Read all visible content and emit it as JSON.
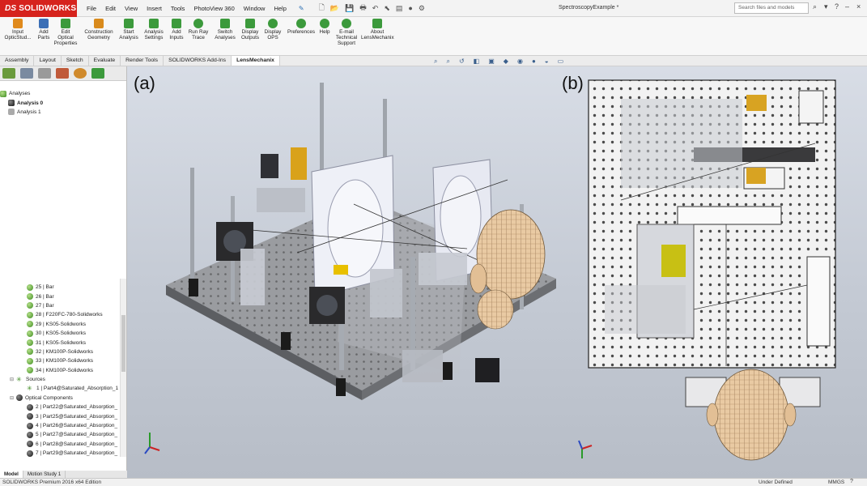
{
  "app": {
    "logo": "SOLIDWORKS",
    "menus": [
      "File",
      "Edit",
      "View",
      "Insert",
      "Tools",
      "PhotoView 360",
      "Window",
      "Help"
    ],
    "document_title": "SpectroscopyExample *",
    "search_placeholder": "Search files and models"
  },
  "ribbon": [
    {
      "label": "Input OpticStud...",
      "icon": "optic-stud-icon",
      "color": "#e08a1c"
    },
    {
      "label": "Add Parts",
      "icon": "add-parts-icon",
      "color": "#3b6fb6"
    },
    {
      "label": "Edit Optical Properties",
      "icon": "edit-optical-icon",
      "color": "#3c9a3c"
    },
    {
      "label": "Construction Geometry",
      "icon": "construction-geometry-icon",
      "color": "#d98a1c"
    },
    {
      "label": "Start Analysis",
      "icon": "start-analysis-icon",
      "color": "#3c9a3c"
    },
    {
      "label": "Analysis Settings",
      "icon": "analysis-settings-icon",
      "color": "#3c9a3c"
    },
    {
      "label": "Add Inputs",
      "icon": "add-inputs-icon",
      "color": "#3c9a3c"
    },
    {
      "label": "Run Ray Trace",
      "icon": "ray-trace-icon",
      "color": "#3c9a3c"
    },
    {
      "label": "Switch Analyses",
      "icon": "switch-analyses-icon",
      "color": "#3c9a3c"
    },
    {
      "label": "Display Outputs",
      "icon": "display-outputs-icon",
      "color": "#3c9a3c"
    },
    {
      "label": "Display OPS",
      "icon": "display-ops-icon",
      "color": "#3c9a3c"
    },
    {
      "label": "Preferences",
      "icon": "preferences-icon",
      "color": "#3c9a3c"
    },
    {
      "label": "Help",
      "icon": "help-icon",
      "color": "#3c9a3c"
    },
    {
      "label": "E-mail Technical Support",
      "icon": "email-support-icon",
      "color": "#3c9a3c"
    },
    {
      "label": "About LensMechanix",
      "icon": "about-icon",
      "color": "#3c9a3c"
    }
  ],
  "tabs": [
    "Assembly",
    "Layout",
    "Sketch",
    "Evaluate",
    "Render Tools",
    "SOLIDWORKS Add-Ins",
    "LensMechanix"
  ],
  "active_tab": "LensMechanix",
  "tree_top": {
    "root": "Analyses",
    "items": [
      "Analysis 0",
      "Analysis 1"
    ]
  },
  "tree_bottom": {
    "parts": [
      "25 | Bar",
      "26 | Bar",
      "27 | Bar",
      "28 | F220FC-780-Solidworks",
      "29 | KS05-Solidworks",
      "30 | KS05-Solidworks",
      "31 | KS05-Solidworks",
      "32 | KM100P-Solidworks",
      "33 | KM100P-Solidworks",
      "34 | KM100P-Solidworks"
    ],
    "sources_label": "Sources",
    "sources": [
      "1 | Part4@Saturated_Absorption_1"
    ],
    "optical_label": "Optical Components",
    "optical": [
      "2 | Part22@Saturated_Absorption_",
      "3 | Part25@Saturated_Absorption_",
      "4 | Part26@Saturated_Absorption_",
      "5 | Part27@Saturated_Absorption_",
      "6 | Part28@Saturated_Absorption_",
      "7 | Part29@Saturated_Absorption_"
    ]
  },
  "bottom_tabs": [
    "Model",
    "Motion Study 1"
  ],
  "status": {
    "edition": "SOLIDWORKS Premium 2016 x64 Edition",
    "state": "Under Defined",
    "units": "MMGS"
  },
  "viewport": {
    "label_a": "(a)",
    "label_b": "(b)"
  }
}
